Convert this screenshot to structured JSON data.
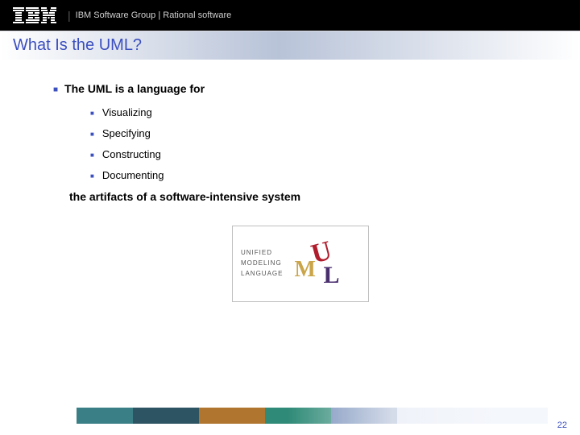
{
  "header": {
    "brand": "IBM",
    "group_text": "IBM Software Group | Rational software"
  },
  "title": "What Is the UML?",
  "intro": "The UML is a language for",
  "bullets": [
    "Visualizing",
    "Specifying",
    "Constructing",
    "Documenting"
  ],
  "outro": "the artifacts of a software-intensive system",
  "uml_logo": {
    "line1": "UNIFIED",
    "line2": "MODELING",
    "line3": "LANGUAGE"
  },
  "page_number": "22"
}
